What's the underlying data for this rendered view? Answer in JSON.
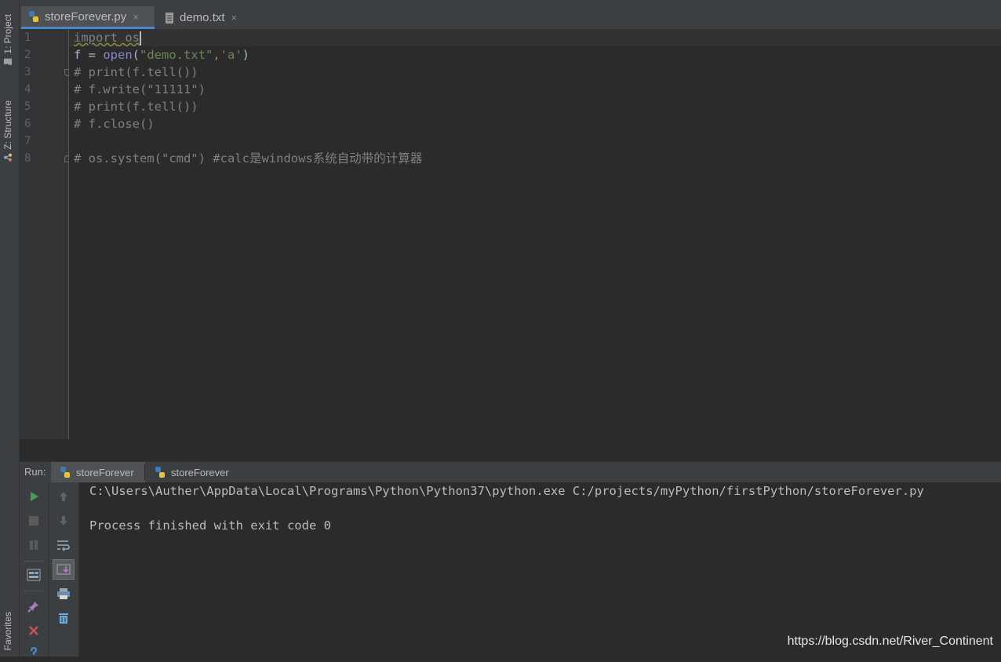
{
  "left_strip": {
    "project_label": "1: Project",
    "structure_label": "Z: Structure",
    "favorites_label": "Favorites"
  },
  "tabs": [
    {
      "label": "storeForever.py",
      "active": true
    },
    {
      "label": "demo.txt",
      "active": false
    }
  ],
  "close_glyph": "×",
  "editor": {
    "line_numbers": [
      "1",
      "2",
      "3",
      "4",
      "5",
      "6",
      "7",
      "8"
    ],
    "lines": {
      "l1_kw": "import",
      "l1_mod": "os",
      "l2_a": "f = ",
      "l2_fn": "open",
      "l2_b": "(",
      "l2_s1": "\"demo.txt\"",
      "l2_c": ",",
      "l2_s2": "'a'",
      "l2_d": ")",
      "l3": "# print(f.tell())",
      "l4": "# f.write(\"11111\")",
      "l5": "# print(f.tell())",
      "l6": "# f.close()",
      "l8": "# os.system(\"cmd\") #calc是windows系统自动带的计算器"
    }
  },
  "run_panel": {
    "label": "Run:",
    "tabs": [
      {
        "label": "storeForever",
        "selected": true
      },
      {
        "label": "storeForever",
        "selected": false
      }
    ],
    "console": [
      "C:\\Users\\Auther\\AppData\\Local\\Programs\\Python\\Python37\\python.exe C:/projects/myPython/firstPython/storeForever.py",
      "",
      "Process finished with exit code 0"
    ]
  },
  "watermark": "https://blog.csdn.net/River_Continent",
  "colors": {
    "accent": "#4a88c7",
    "run_green": "#499c54",
    "close_red": "#c75450"
  }
}
